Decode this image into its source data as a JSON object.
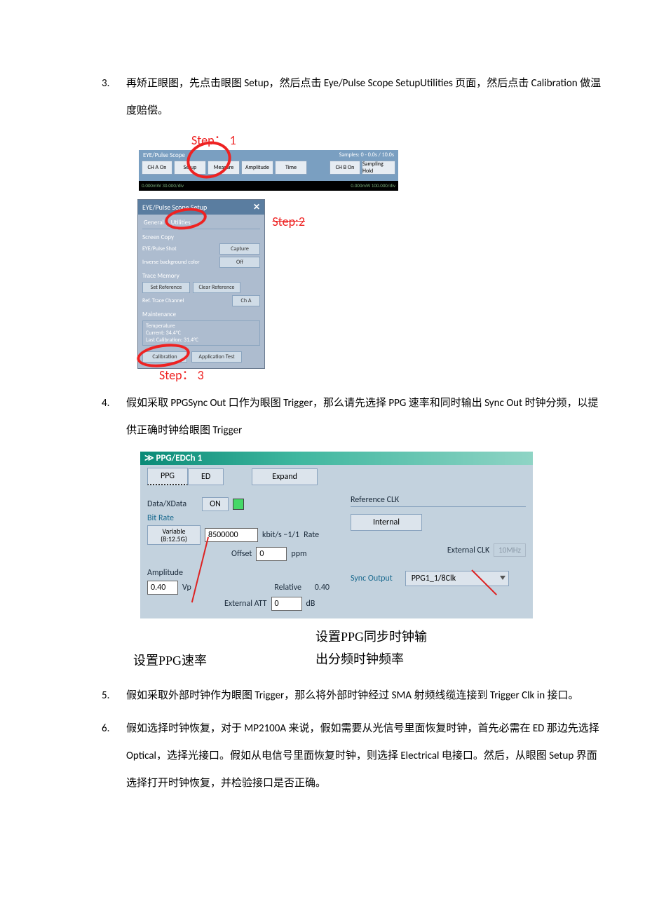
{
  "items": {
    "i3": {
      "num": "3.",
      "text": "再矫正眼图，先点击眼图 Setup，然后点击 Eye/Pulse Scope SetupUtilities 页面，然后点击 Calibration 做温度赔偿。"
    },
    "i4": {
      "num": "4.",
      "text": "假如采取 PPGSync Out 口作为眼图 Trigger，那么请先选择 PPG 速率和同时输出 Sync Out 时钟分频，以提供正确时钟给眼图 Trigger"
    },
    "i5": {
      "num": "5.",
      "text": "假如采取外部时钟作为眼图 Trigger，那么将外部时钟经过 SMA 射频线缆连接到 Trigger Clk in 接口。"
    },
    "i6": {
      "num": "6.",
      "text": "假如选择时钟恢复，对于 MP2100A 来说，假如需要从光信号里面恢复时钟，首先必需在 ED 那边先选择 Optical，选择光接口。假如从电信号里面恢复时钟，则选择 Electrical 电接口。然后，从眼图 Setup 界面选择打开时钟恢复，并检验接口是否正确。"
    }
  },
  "steps": {
    "s1": "Step： 1",
    "s2": "Step:2",
    "s3": "Step： 3"
  },
  "scopeTop": {
    "title": "EYE/Pulse Scope",
    "samples": "Samples: 0 - 0.0s / 10.0s",
    "chA": "CH A On",
    "setup": "Setup",
    "measure": "Measure",
    "amplitude": "Amplitude",
    "time": "Time",
    "chB": "CH B On",
    "sampling": "Sampling Hold",
    "greenL": "0.000mW\n30.000/div",
    "greenR": "0.000mW\n100.000/div"
  },
  "scopeSetup": {
    "title": "EYE/Pulse Scope Setup",
    "close": "✕",
    "tabGeneral": "General",
    "tabUtilities": "Utilities",
    "secScreenCopy": "Screen Copy",
    "lblShot": "EYE/Pulse Shot",
    "btnCapture": "Capture",
    "lblInverse": "Inverse background color",
    "btnOff": "Off",
    "secTrace": "Trace Memory",
    "btnSetRef": "Set Reference",
    "btnClearRef": "Clear Reference",
    "lblRefTrace": "Ref. Trace Channel",
    "btnChA": "Ch A",
    "secMaint": "Maintenance",
    "tTemp": "Temperature",
    "tCurrent": "Current: 34.4°C",
    "tLast": "Last Calibration: 31.4°C",
    "btnCalibration": "Calibration",
    "btnAppTest": "Application Test"
  },
  "ppg": {
    "title": "≫ PPG/EDCh 1",
    "tabPPG": "PPG",
    "tabED": "ED",
    "expand": "Expand",
    "dataXData": "Data/XData",
    "on": "ON",
    "bitRate": "Bit Rate",
    "variable1": "Variable",
    "variable2": "(8:12.5G)",
    "bitrateVal": "8500000",
    "kbits": "kbit/s −1/1",
    "rate": "Rate",
    "offset": "Offset",
    "offsetVal": "0",
    "ppm": "ppm",
    "amplitude": "Amplitude",
    "ampVal": "0.40",
    "vp": "Vp",
    "relative": "Relative",
    "relVal": "0.40",
    "extAtt": "External ATT",
    "extAttVal": "0",
    "dB": "dB",
    "refClk": "Reference CLK",
    "internal": "Internal",
    "externalClk": "External CLK",
    "tenMHz": "10MHz",
    "syncOutput": "Sync Output",
    "syncSel": "PPG1_1/8Clk"
  },
  "annotations": {
    "left": "设置PPG速率",
    "right1": "设置PPG同步时钟输",
    "right2": "出分频时钟频率"
  }
}
